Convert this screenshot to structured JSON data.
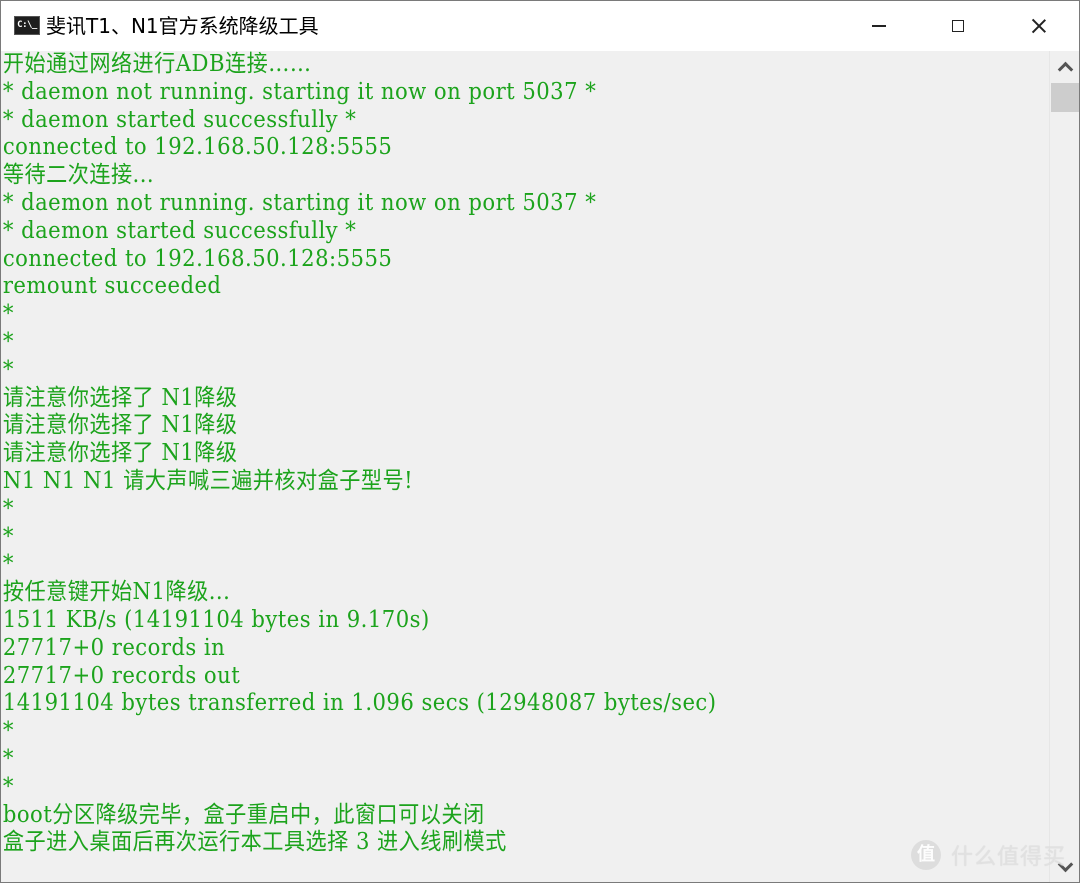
{
  "window": {
    "title": "斐讯T1、N1官方系统降级工具",
    "app_icon_label": "C:\\_",
    "icons": {
      "app": "console-icon",
      "minimize": "minimize-icon",
      "maximize": "maximize-icon",
      "close": "close-icon"
    }
  },
  "console": {
    "text_color": "#1ca31c",
    "background": "#f0f0f0",
    "lines": [
      "开始通过网络进行ADB连接……",
      "* daemon not running. starting it now on port 5037 *",
      "* daemon started successfully *",
      "connected to 192.168.50.128:5555",
      "等待二次连接...",
      "* daemon not running. starting it now on port 5037 *",
      "* daemon started successfully *",
      "connected to 192.168.50.128:5555",
      "remount succeeded",
      "*",
      "*",
      "*",
      "请注意你选择了 N1降级",
      "请注意你选择了 N1降级",
      "请注意你选择了 N1降级",
      "N1 N1 N1 请大声喊三遍并核对盒子型号!",
      "*",
      "*",
      "*",
      "按任意键开始N1降级...",
      "1511 KB/s (14191104 bytes in 9.170s)",
      "27717+0 records in",
      "27717+0 records out",
      "14191104 bytes transferred in 1.096 secs (12948087 bytes/sec)",
      "*",
      "*",
      "*",
      "boot分区降级完毕，盒子重启中，此窗口可以关闭",
      "盒子进入桌面后再次运行本工具选择 3 进入线刷模式"
    ]
  },
  "scrollbar": {
    "position": 0
  },
  "watermark": {
    "badge": "值",
    "text": "什么值得买"
  }
}
